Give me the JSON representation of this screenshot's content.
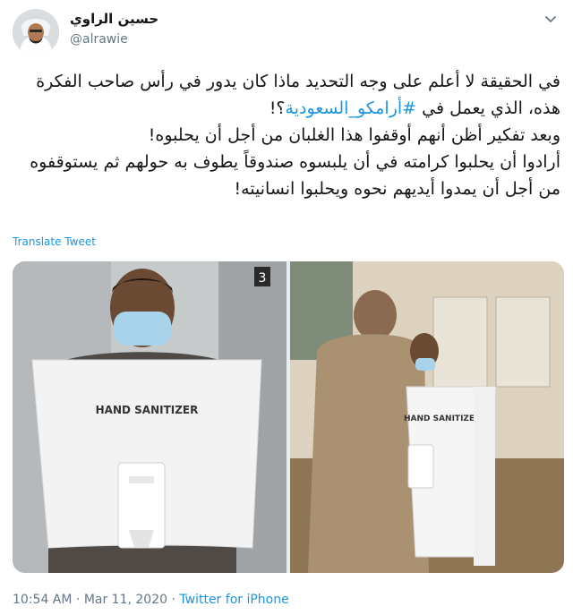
{
  "author": {
    "name": "حسين الراوي",
    "handle": "@alrawie"
  },
  "tweet": {
    "line1": "في الحقيقة لا أعلم على وجه التحديد ماذا كان يدور في رأس صاحب الفكرة",
    "line2_prefix": "هذه، الذي يعمل في",
    "line2_hashtag": "#أرامكو_السعودية",
    "line2_suffix": "؟!",
    "line3": "وبعد تفكير أظن أنهم أوقفوا هذا الغلبان من أجل أن يحلبوه!",
    "line4": "أرادوا أن يحلبوا كرامته في أن يلبسوه صندوقاً يطوف به حولهم ثم يستوقفوه",
    "line5": "من أجل أن يمدوا أيديهم نحوه ويحلبوا انسانيته!"
  },
  "translate_label": "Translate Tweet",
  "media": {
    "left_photo_text": "HAND SANITIZER",
    "right_photo_text": "HAND SANITIZER",
    "elevator_number": "3"
  },
  "footer": {
    "time": "10:54 AM",
    "separator": "·",
    "date": "Mar 11, 2020",
    "source": "Twitter for iPhone"
  }
}
